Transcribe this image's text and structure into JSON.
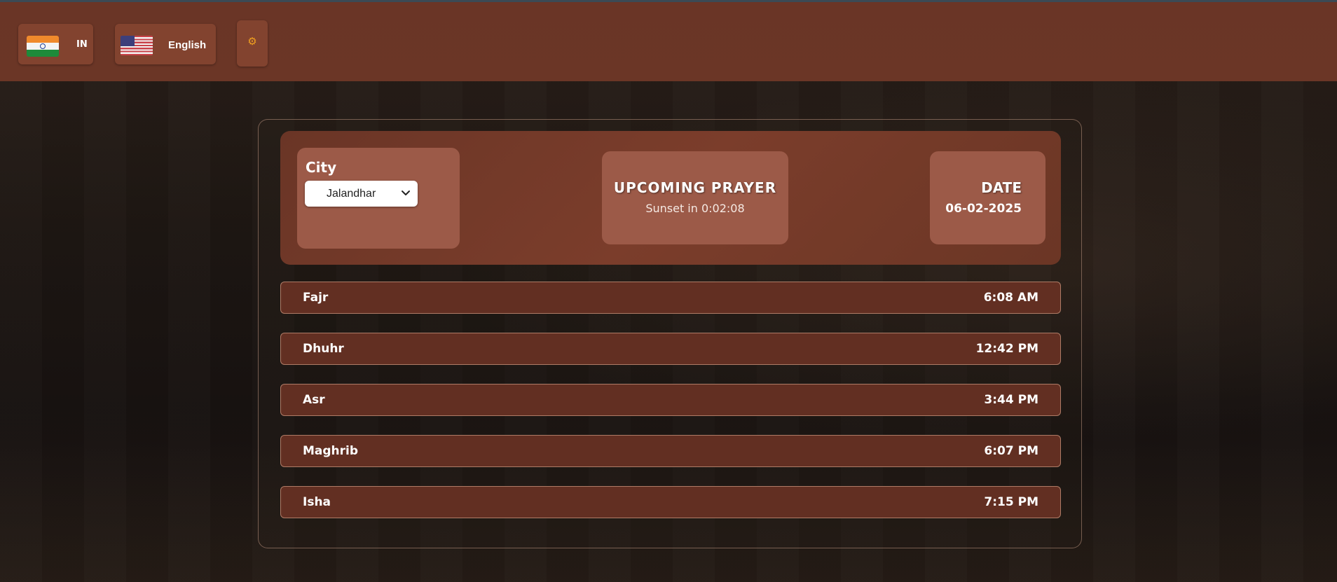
{
  "topbar": {
    "country_code": "IN",
    "country_flag_icon": "india-flag-icon",
    "language": "English",
    "language_flag_icon": "us-flag-icon",
    "theme_icon": "sun-icon"
  },
  "header": {
    "city_label": "City",
    "city_selected": "Jalandhar",
    "upcoming_title": "UPCOMING PRAYER",
    "upcoming_text": "Sunset in 0:02:08",
    "date_title": "DATE",
    "date_value": "06-02-2025"
  },
  "prayers": [
    {
      "name": "Fajr",
      "time": "6:08 AM"
    },
    {
      "name": "Dhuhr",
      "time": "12:42 PM"
    },
    {
      "name": "Asr",
      "time": "3:44 PM"
    },
    {
      "name": "Maghrib",
      "time": "6:07 PM"
    },
    {
      "name": "Isha",
      "time": "7:15 PM"
    }
  ],
  "colors": {
    "topbar": "#6a3526",
    "button": "#82432f",
    "card": "#9c5a48",
    "row": "#622f22",
    "accent": "#f0a020"
  }
}
